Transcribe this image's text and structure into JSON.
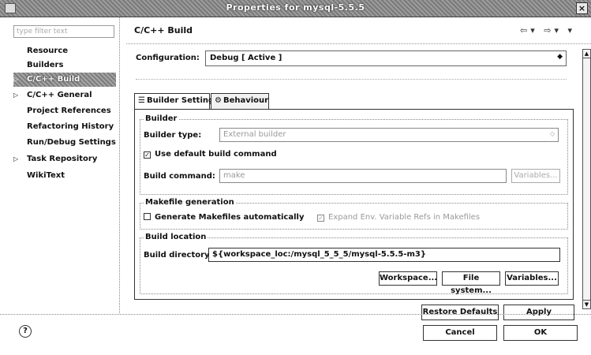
{
  "window": {
    "title": "Properties for mysql-5.5.5",
    "close": "×"
  },
  "sidebar": {
    "filter_placeholder": "type filter text",
    "items": [
      {
        "label": "Resource",
        "arrow": ""
      },
      {
        "label": "Builders",
        "arrow": ""
      },
      {
        "label": "C/C++ Build",
        "arrow": "▷"
      },
      {
        "label": "C/C++ General",
        "arrow": "▷"
      },
      {
        "label": "Project References",
        "arrow": ""
      },
      {
        "label": "Refactoring History",
        "arrow": ""
      },
      {
        "label": "Run/Debug Settings",
        "arrow": ""
      },
      {
        "label": "Task Repository",
        "arrow": "▷"
      },
      {
        "label": "WikiText",
        "arrow": ""
      }
    ]
  },
  "header": {
    "title": "C/C++ Build",
    "nav_icons": "⇦▾ ⇨▾ ▾"
  },
  "configuration": {
    "label": "Configuration:",
    "value": "Debug  [ Active ]"
  },
  "tabs": [
    {
      "label": "Builder Settings",
      "icon": "☰"
    },
    {
      "label": "Behaviour",
      "icon": "⚙"
    }
  ],
  "builder": {
    "legend": "Builder",
    "type_label": "Builder type:",
    "type_value": "External builder",
    "use_default_label": "Use default build command",
    "use_default_checked": true,
    "command_label": "Build command:",
    "command_value": "make",
    "variables_label": "Variables..."
  },
  "makefile": {
    "legend": "Makefile generation",
    "generate_label": "Generate Makefiles automatically",
    "generate_checked": false,
    "expand_label": "Expand Env. Variable Refs in Makefiles",
    "expand_checked": true
  },
  "location": {
    "legend": "Build location",
    "dir_label": "Build directory:",
    "dir_value": "${workspace_loc:/mysql_5_5_5/mysql-5.5.5-m3}",
    "workspace_label": "Workspace...",
    "filesystem_label": "File system...",
    "variables_label": "Variables..."
  },
  "footer": {
    "restore_label": "Restore Defaults",
    "apply_label": "Apply",
    "cancel_label": "Cancel",
    "ok_label": "OK",
    "help_icon": "?"
  }
}
